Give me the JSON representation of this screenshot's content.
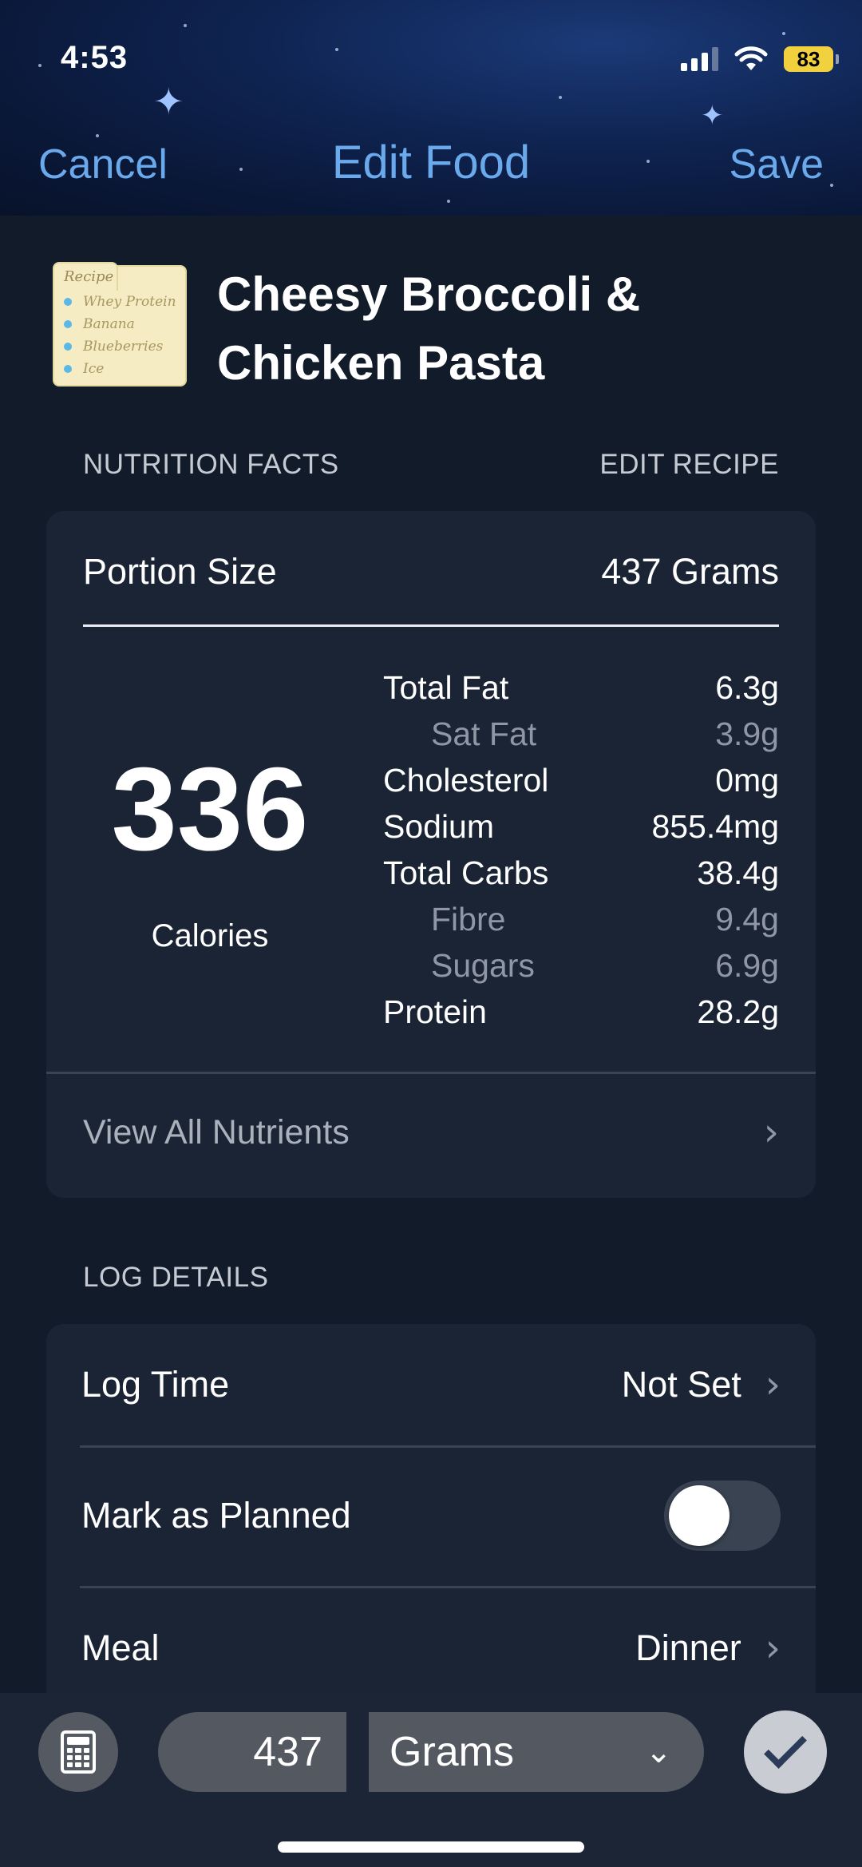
{
  "status_bar": {
    "time": "4:53",
    "battery": "83"
  },
  "nav": {
    "cancel": "Cancel",
    "title": "Edit Food",
    "save": "Save"
  },
  "food": {
    "name": "Cheesy Broccoli & Chicken Pasta",
    "icon": "recipe-card-icon",
    "recipe_card": {
      "tab": "Recipe",
      "items": [
        "Whey Protein",
        "Banana",
        "Blueberries",
        "Ice"
      ]
    }
  },
  "nutrition": {
    "section_label": "NUTRITION FACTS",
    "edit_recipe": "EDIT RECIPE",
    "portion_label": "Portion Size",
    "portion_value": "437 Grams",
    "calories": "336",
    "calories_label": "Calories",
    "rows": [
      {
        "label": "Total Fat",
        "value": "6.3g",
        "sub": false
      },
      {
        "label": "Sat Fat",
        "value": "3.9g",
        "sub": true
      },
      {
        "label": "Cholesterol",
        "value": "0mg",
        "sub": false
      },
      {
        "label": "Sodium",
        "value": "855.4mg",
        "sub": false
      },
      {
        "label": "Total Carbs",
        "value": "38.4g",
        "sub": false
      },
      {
        "label": "Fibre",
        "value": "9.4g",
        "sub": true
      },
      {
        "label": "Sugars",
        "value": "6.9g",
        "sub": true
      },
      {
        "label": "Protein",
        "value": "28.2g",
        "sub": false
      }
    ],
    "view_all": "View All Nutrients"
  },
  "log_details": {
    "section_label": "LOG DETAILS",
    "log_time_label": "Log Time",
    "log_time_value": "Not Set",
    "mark_planned_label": "Mark as Planned",
    "mark_planned_on": false,
    "meal_label": "Meal",
    "meal_value": "Dinner"
  },
  "bottom_bar": {
    "quantity": "437",
    "unit": "Grams",
    "calculator_icon": "calculator-icon",
    "confirm_icon": "checkmark-icon"
  },
  "colors": {
    "accent": "#6aa9ec",
    "card": "#1a2435",
    "background": "#111b29"
  }
}
